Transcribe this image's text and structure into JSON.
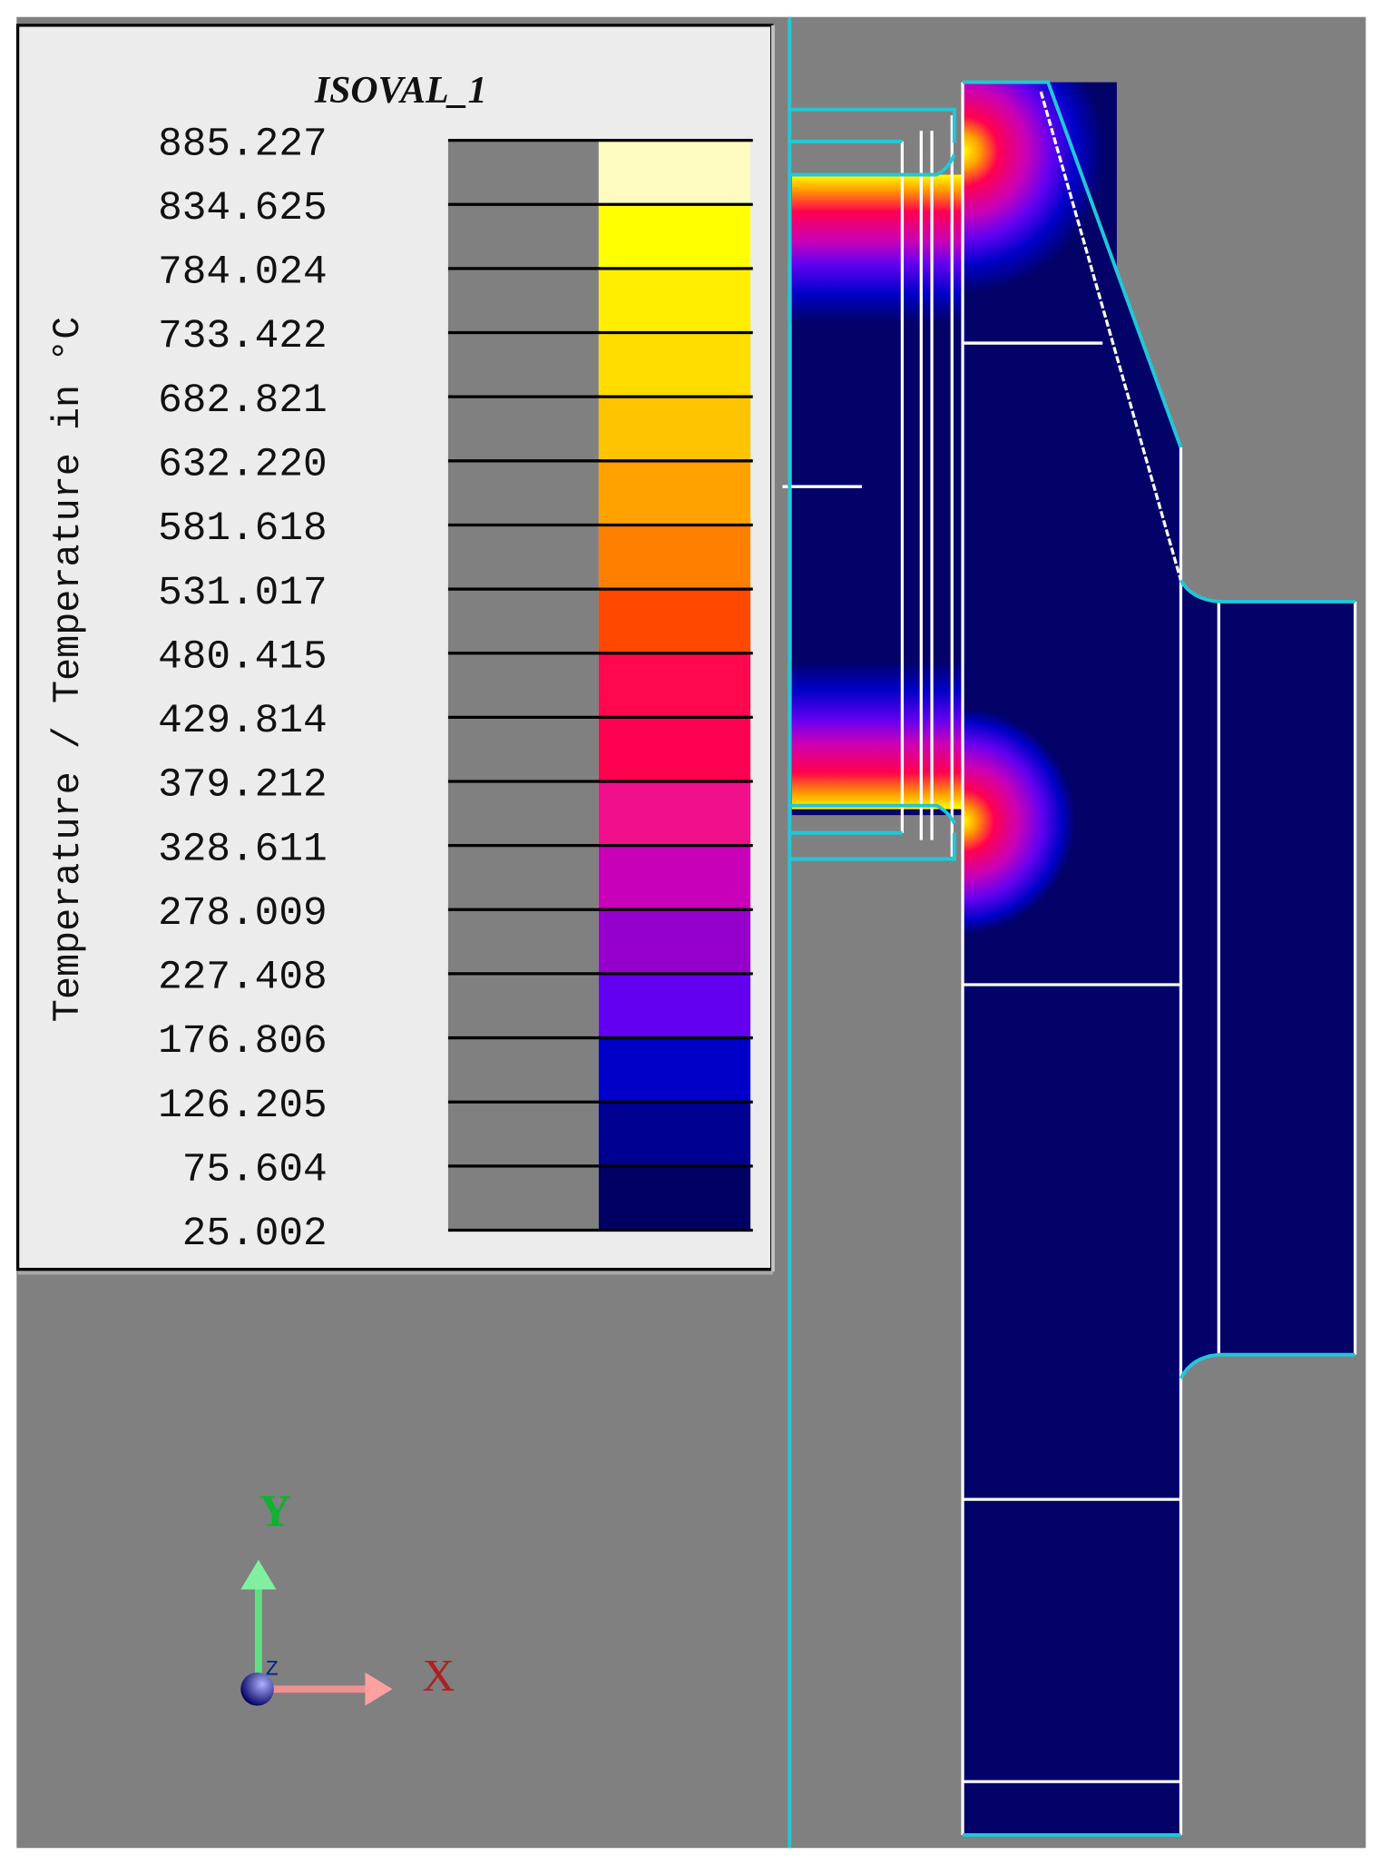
{
  "chart_data": {
    "type": "heatmap",
    "title": "ISOVAL_1",
    "colorbar_label": "Temperature / Temperature in °C",
    "colorbar_ticks": [
      "885.227",
      "834.625",
      "784.024",
      "733.422",
      "682.821",
      "632.220",
      "581.618",
      "531.017",
      "480.415",
      "429.814",
      "379.212",
      "328.611",
      "278.009",
      "227.408",
      "176.806",
      "126.205",
      "75.604",
      "25.002"
    ],
    "range": [
      25.002,
      885.227
    ],
    "band_colors": [
      "#fdfbc0",
      "#ffff00",
      "#ffee00",
      "#ffdd00",
      "#ffc400",
      "#ffa200",
      "#ff8000",
      "#ff4800",
      "#ff0850",
      "#ff0050",
      "#f0108c",
      "#c800b8",
      "#9600cc",
      "#6400f0",
      "#0000c8",
      "#000090",
      "#000064"
    ],
    "legend_placement": "top-left"
  },
  "axes_triad": {
    "x_label": "X",
    "y_label": "Y",
    "z_label": "Z"
  },
  "colors": {
    "background": "#808080",
    "part": "#020268",
    "outline_cyan": "#20c8d8",
    "edge_white": "#ffffff",
    "legend_bg": "#ececec"
  }
}
